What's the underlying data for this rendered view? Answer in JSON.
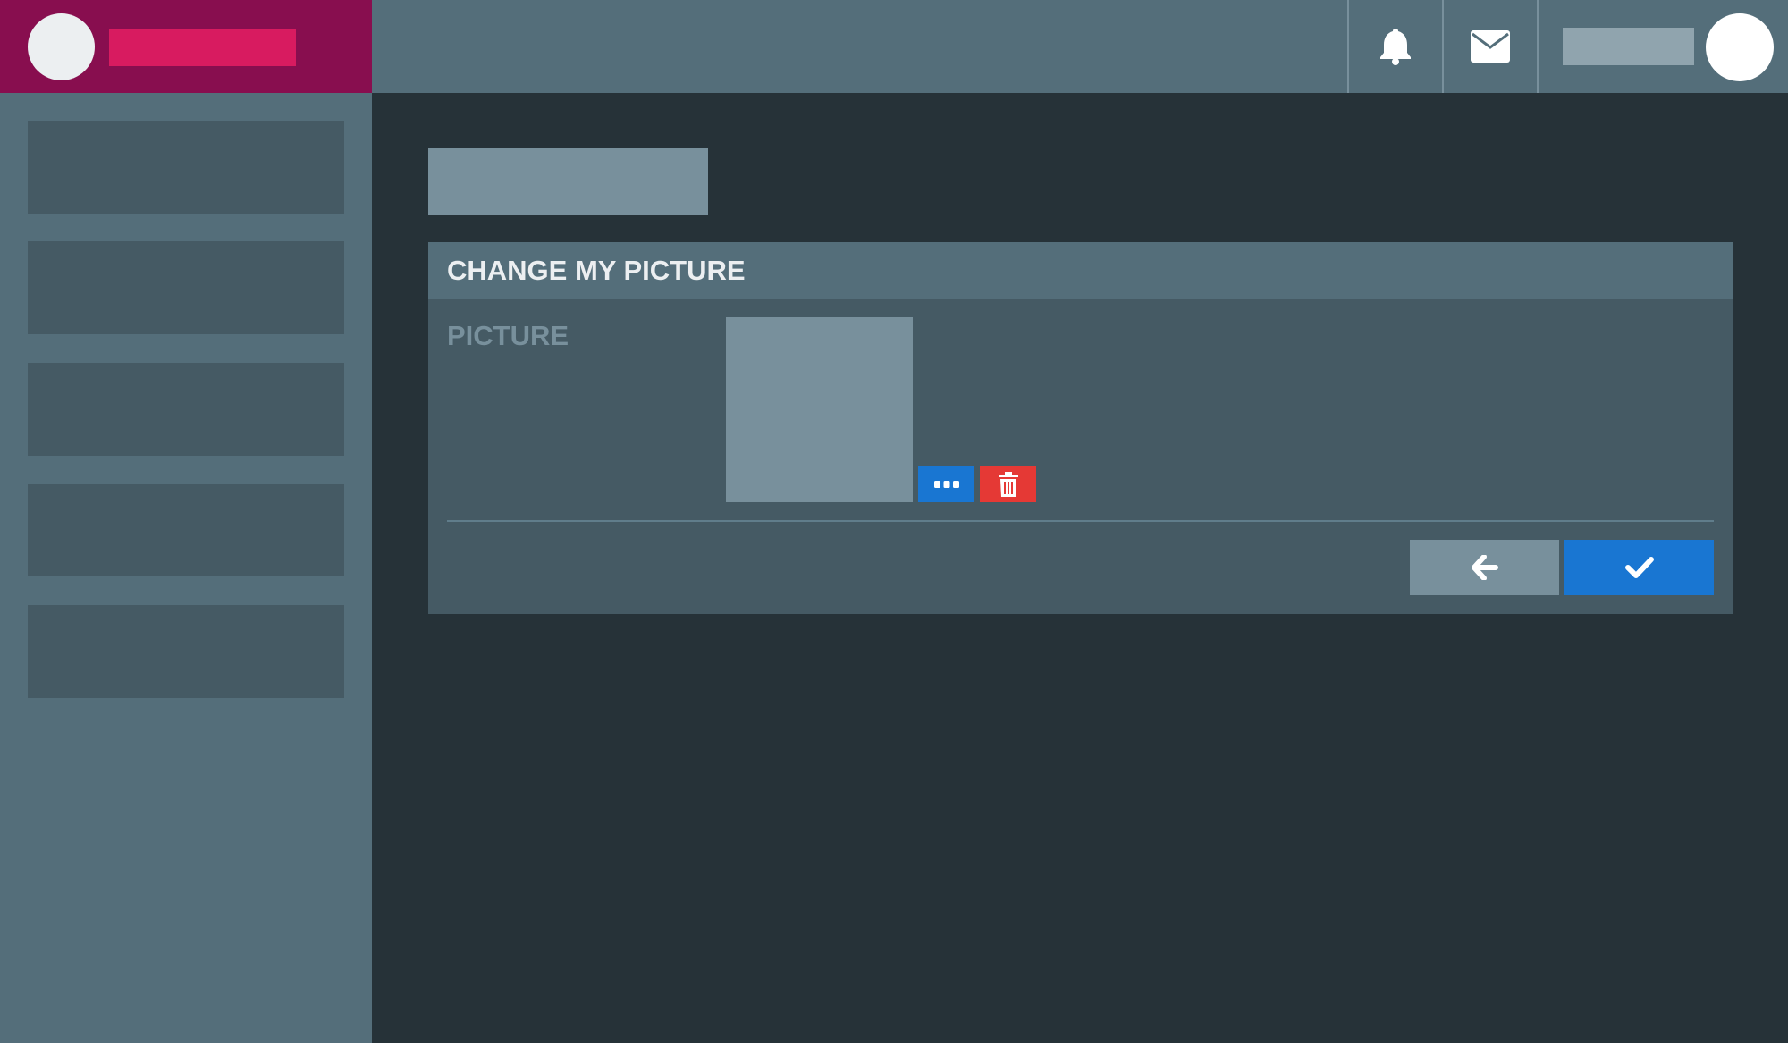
{
  "colors": {
    "brand_bg": "#880e4f",
    "brand_accent": "#d81b60",
    "topbar_bg": "#546e7a",
    "sidebar_bg": "#546e7a",
    "sidebar_item_bg": "#455a64",
    "content_bg": "#263238",
    "card_bg": "#455a64",
    "card_header_bg": "#546e7a",
    "primary": "#1976d2",
    "danger": "#e53935",
    "muted": "#78909c"
  },
  "topbar": {
    "icons": [
      "bell-icon",
      "envelope-icon"
    ]
  },
  "card": {
    "title": "CHANGE MY PICTURE",
    "field_label": "PICTURE",
    "picture_buttons": [
      "ellipsis-icon",
      "trash-icon"
    ],
    "footer_buttons": [
      "arrow-left-icon",
      "check-icon"
    ]
  }
}
